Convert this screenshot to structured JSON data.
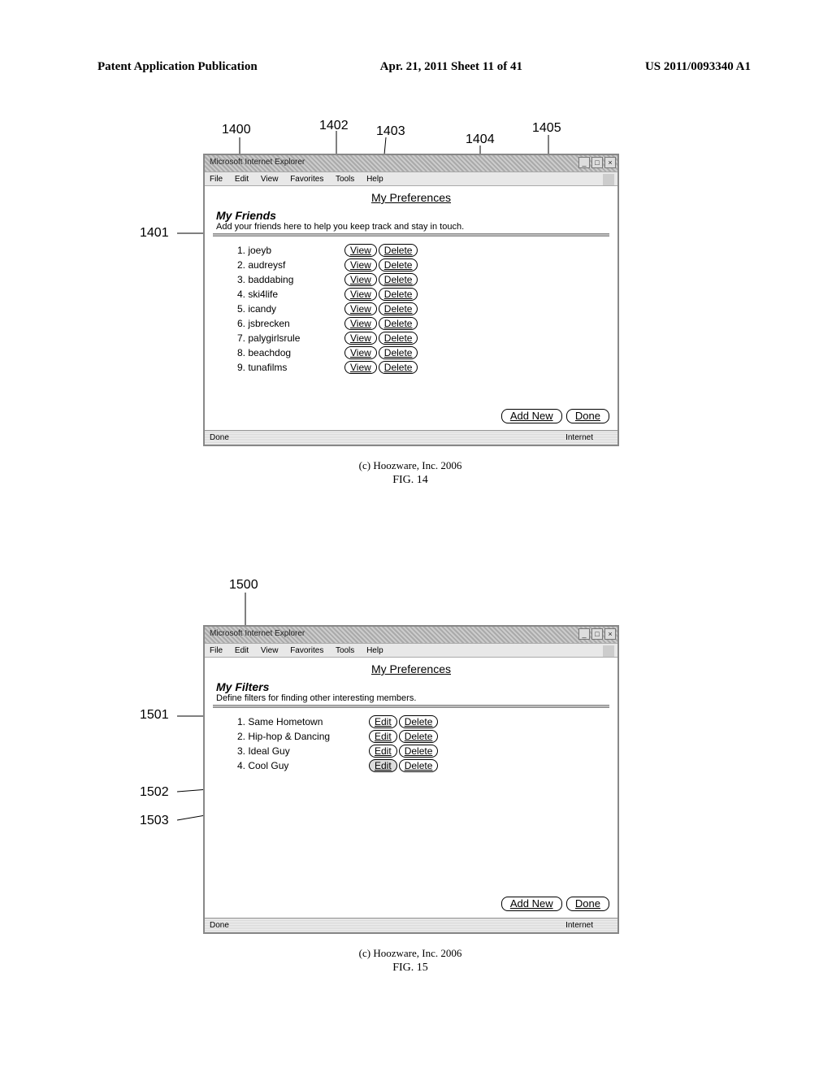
{
  "header": {
    "left": "Patent Application Publication",
    "mid": "Apr. 21, 2011  Sheet 11 of 41",
    "right": "US 2011/0093340 A1"
  },
  "fig14": {
    "browser_title": "Microsoft Internet Explorer",
    "menus": [
      "File",
      "Edit",
      "View",
      "Favorites",
      "Tools",
      "Help"
    ],
    "page_heading": "My Preferences",
    "section_title": "My Friends",
    "subdesc": "Add your friends here to help you keep track and stay in touch.",
    "friends": [
      "joeyb",
      "audreysf",
      "baddabing",
      "ski4life",
      "icandy",
      "jsbrecken",
      "palygirlsrule",
      "beachdog",
      "tunafilms"
    ],
    "view_label": "View",
    "delete_label": "Delete",
    "addnew_label": "Add New",
    "done_label": "Done",
    "status_left": "Done",
    "status_right": "Internet",
    "caption": "(c) Hoozware, Inc. 2006",
    "fig_label": "FIG. 14",
    "callouts": {
      "c1400": "1400",
      "c1401": "1401",
      "c1402": "1402",
      "c1403": "1403",
      "c1404": "1404",
      "c1405": "1405"
    }
  },
  "fig15": {
    "browser_title": "Microsoft Internet Explorer",
    "menus": [
      "File",
      "Edit",
      "View",
      "Favorites",
      "Tools",
      "Help"
    ],
    "page_heading": "My Preferences",
    "section_title": "My Filters",
    "subdesc": "Define filters for finding other interesting members.",
    "filters": [
      "Same Hometown",
      "Hip-hop & Dancing",
      "Ideal Guy",
      "Cool Guy"
    ],
    "edit_label": "Edit",
    "delete_label": "Delete",
    "selected_index": 3,
    "addnew_label": "Add New",
    "done_label": "Done",
    "status_left": "Done",
    "status_right": "Internet",
    "caption": "(c) Hoozware, Inc. 2006",
    "fig_label": "FIG. 15",
    "callouts": {
      "c1500": "1500",
      "c1501": "1501",
      "c1502": "1502",
      "c1503": "1503"
    }
  }
}
